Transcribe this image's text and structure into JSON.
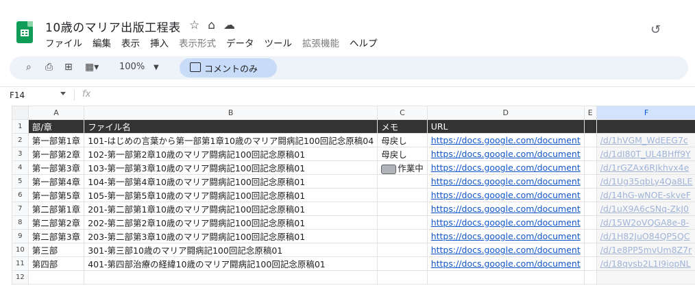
{
  "app": {
    "title": "10歳のマリア出版工程表",
    "menu": [
      "ファイル",
      "編集",
      "表示",
      "挿入",
      "表示形式",
      "データ",
      "ツール",
      "拡張機能",
      "ヘルプ"
    ],
    "menu_dim": [
      false,
      false,
      false,
      false,
      true,
      false,
      false,
      true,
      false
    ]
  },
  "toolbar": {
    "zoom": "100%",
    "comment_mode": "コメントのみ"
  },
  "formula_bar": {
    "cell_ref": "F14",
    "fx": "fx"
  },
  "columns": [
    "A",
    "B",
    "C",
    "D",
    "E",
    "F"
  ],
  "rows": [
    {
      "num": "1",
      "a": "部/章",
      "b": "ファイル名",
      "c": "メモ",
      "d": "URL",
      "e": "",
      "f": ""
    },
    {
      "num": "2",
      "a": "第一部第1章",
      "b": "101-はじめの言葉から第一部第1章10歳のマリア闘病記100回記念原稿04",
      "c": "母戻し",
      "d": "https://docs.google.com/document",
      "e": "",
      "f": "/d/1hVGM_WdEEG7c"
    },
    {
      "num": "3",
      "a": "第一部第2章",
      "b": "102-第一部第2章10歳のマリア闘病記100回記念原稿01",
      "c": "母戻し",
      "d": "https://docs.google.com/document",
      "e": "",
      "f": "/d/1dI80T_UL4BHff9Y"
    },
    {
      "num": "4",
      "a": "第一部第3章",
      "b": "103-第一部第3章10歳のマリア闘病記100回記念原稿01",
      "c": "作業中",
      "d": "https://docs.google.com/document",
      "e": "",
      "f": "/d/1rGZAx6RJkhvx4e"
    },
    {
      "num": "5",
      "a": "第一部第4章",
      "b": "104-第一部第4章10歳のマリア闘病記100回記念原稿01",
      "c": "",
      "d": "https://docs.google.com/document",
      "e": "",
      "f": "/d/1Ug35qbLy4Qa8LE"
    },
    {
      "num": "6",
      "a": "第一部第5章",
      "b": "105-第一部第5章10歳のマリア闘病記100回記念原稿01",
      "c": "",
      "d": "https://docs.google.com/document",
      "e": "",
      "f": "/d/14hG-wNOE-skveF"
    },
    {
      "num": "7",
      "a": "第二部第1章",
      "b": "201-第二部第1章10歳のマリア闘病記100回記念原稿01",
      "c": "",
      "d": "https://docs.google.com/document",
      "e": "",
      "f": "/d/1uX9A6cSNq-ZkJ0"
    },
    {
      "num": "8",
      "a": "第二部第2章",
      "b": "202-第二部第2章10歳のマリア闘病記100回記念原稿01",
      "c": "",
      "d": "https://docs.google.com/document",
      "e": "",
      "f": "/d/15W2oVQGA8e-8-"
    },
    {
      "num": "9",
      "a": "第二部第3章",
      "b": "203-第二部第3章10歳のマリア闘病記100回記念原稿01",
      "c": "",
      "d": "https://docs.google.com/document",
      "e": "",
      "f": "/d/1H82JuO84QP5QC"
    },
    {
      "num": "10",
      "a": "第三部",
      "b": "301-第三部10歳のマリア闘病記100回記念原稿01",
      "c": "",
      "d": "https://docs.google.com/document",
      "e": "",
      "f": "/d/1e8PP5mvUm8Z7r"
    },
    {
      "num": "11",
      "a": "第四部",
      "b": "401-第四部治療の経緯10歳のマリア闘病記100回記念原稿01",
      "c": "",
      "d": "https://docs.google.com/document",
      "e": "",
      "f": "/d/18qvsb2L1I9iopNL"
    },
    {
      "num": "12",
      "a": "",
      "b": "",
      "c": "",
      "d": "",
      "e": "",
      "f": ""
    }
  ],
  "colors": {
    "accent": "#0b57d0",
    "header_row": "#333333",
    "link": "#1155cc",
    "logo": "#0f9d58"
  },
  "icons": [
    "star-icon",
    "move-to-drive-icon",
    "cloud-status-icon",
    "history-icon",
    "search-icon",
    "print-icon",
    "add-comment-icon",
    "table-view-icon",
    "comment-mode-icon",
    "dropdown-caret-icon"
  ]
}
